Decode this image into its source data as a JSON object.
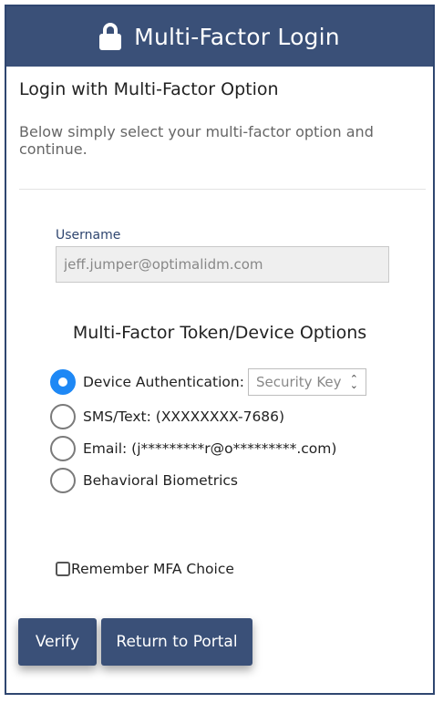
{
  "header": {
    "title": "Multi-Factor Login",
    "icon": "lock-icon"
  },
  "section": {
    "title": "Login with Multi-Factor Option",
    "description": "Below simply select your multi-factor option and continue."
  },
  "username": {
    "label": "Username",
    "value": "jeff.jumper@optimalidm.com"
  },
  "options": {
    "title": "Multi-Factor Token/Device Options",
    "items": [
      {
        "label": "Device Authentication:",
        "checked": true,
        "select_value": "Security Key"
      },
      {
        "label": "SMS/Text: (XXXXXXXX-7686)",
        "checked": false
      },
      {
        "label": "Email: (j*********r@o*********.com)",
        "checked": false
      },
      {
        "label": "Behavioral Biometrics",
        "checked": false
      }
    ]
  },
  "remember": {
    "label": "Remember MFA Choice",
    "checked": false
  },
  "buttons": {
    "verify": "Verify",
    "return": "Return to Portal"
  },
  "colors": {
    "header_bg": "#3a5078",
    "radio_selected": "#1e88f5",
    "border": "#2f4670"
  }
}
